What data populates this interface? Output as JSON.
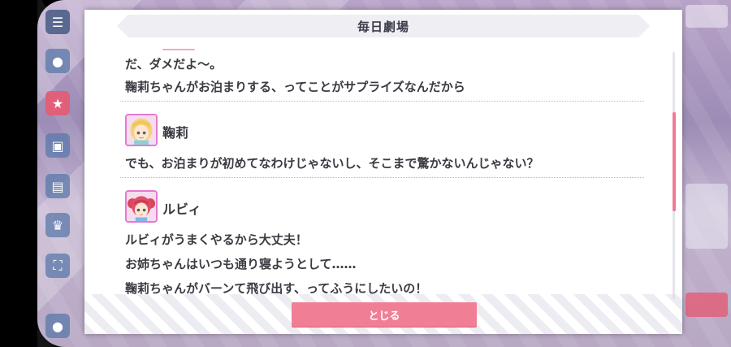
{
  "dialog": {
    "title": "毎日劇場",
    "close_label": "とじる"
  },
  "script": {
    "lines_top": [
      "だ、ダメだよ〜。",
      "鞠莉ちゃんがお泊まりする、ってことがサプライズなんだから"
    ],
    "block_mari": {
      "speaker": "鞠莉",
      "lines": [
        "でも、お泊まりが初めてなわけじゃないし、そこまで驚かないんじゃない？"
      ]
    },
    "block_ruby": {
      "speaker": "ルビィ",
      "lines": [
        "ルビィがうまくやるから大丈夫！",
        "お姉ちゃんはいつも通り寝ようとして……",
        "鞠莉ちゃんがバーンて飛び出す、ってふうにしたいの！"
      ]
    }
  },
  "colors": {
    "accent": "#f07f95",
    "scroll_thumb": "#f07a94",
    "text": "#3a3a42",
    "avatar_border": "#e47ad0"
  },
  "icons": {
    "menu": "menu-icon",
    "chat": "chat-icon",
    "present": "present-icon",
    "gift": "gift-icon",
    "story": "story-icon",
    "ranking": "ranking-icon",
    "fullscreen": "fullscreen-icon"
  }
}
